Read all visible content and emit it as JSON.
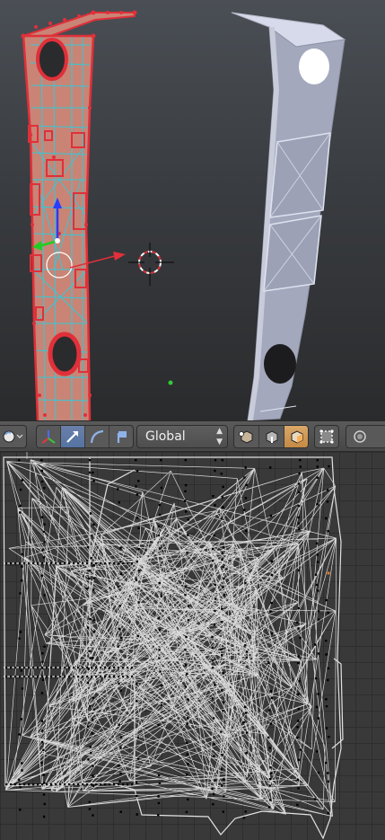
{
  "viewport": {
    "accent_selected": "#e0303a",
    "accent_edges": "#35c8d8",
    "face_fill": "#c98475",
    "mesh_gray": "#a7acc0"
  },
  "toolbar": {
    "viewport_shading_icon": "sphere-icon",
    "manipulator_icon": "transform-axes-icon",
    "translate_icon": "arrow-icon",
    "rotate_icon": "arc-icon",
    "scale_icon": "scale-icon",
    "orientation": "Global",
    "select_mode_icons": [
      "vertex-select-icon",
      "edge-select-icon",
      "face-select-icon"
    ],
    "occlude_icon": "limit-selection-icon",
    "proportional_icon": "proportional-edit-icon"
  },
  "uv_editor": {
    "wire_color": "#d8d8d8",
    "vertex_color": "#000000"
  }
}
